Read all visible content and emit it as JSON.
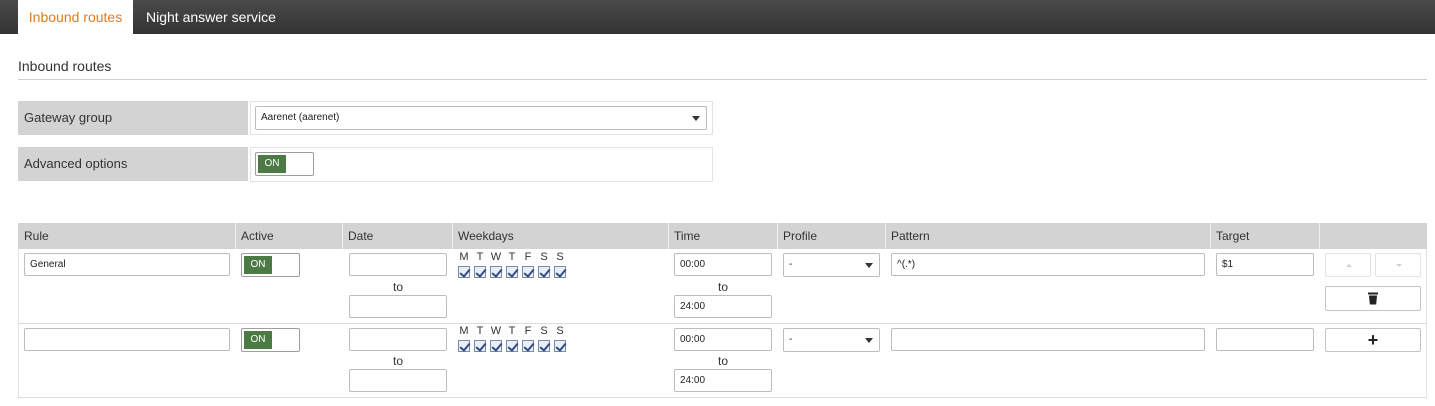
{
  "tabs": [
    {
      "label": "Inbound routes",
      "active": true
    },
    {
      "label": "Night answer service",
      "active": false
    }
  ],
  "section_title": "Inbound routes",
  "options": {
    "gateway_group": {
      "label": "Gateway group",
      "value": "Aarenet (aarenet)"
    },
    "advanced_options": {
      "label": "Advanced options",
      "toggle": "ON"
    }
  },
  "table": {
    "headers": [
      "Rule",
      "Active",
      "Date",
      "Weekdays",
      "Time",
      "Profile",
      "Pattern",
      "Target"
    ],
    "weekday_letters": [
      "M",
      "T",
      "W",
      "T",
      "F",
      "S",
      "S"
    ],
    "to_label": "to",
    "rows": [
      {
        "rule": "General",
        "active": "ON",
        "date_from": "",
        "date_to": "",
        "time_from": "00:00",
        "time_to": "24:00",
        "profile": "-",
        "pattern": "^(.*)",
        "target": "$1"
      },
      {
        "rule": "",
        "active": "ON",
        "date_from": "",
        "date_to": "",
        "time_from": "00:00",
        "time_to": "24:00",
        "profile": "-",
        "pattern": "",
        "target": ""
      }
    ]
  },
  "accent_color": "#e07b20",
  "toggle_color": "#4c7a45"
}
